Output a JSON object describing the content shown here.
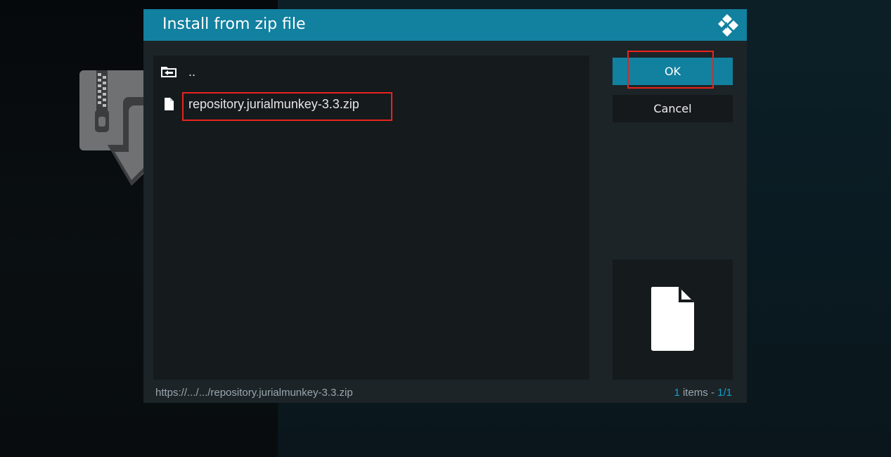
{
  "dialog": {
    "title": "Install from zip file"
  },
  "file_list": {
    "items": [
      {
        "label": "..",
        "icon": "folder-back-icon"
      },
      {
        "label": "repository.jurialmunkey-3.3.zip",
        "icon": "file-icon"
      }
    ]
  },
  "buttons": {
    "ok_label": "OK",
    "cancel_label": "Cancel"
  },
  "status": {
    "path": "https://.../.../repository.jurialmunkey-3.3.zip",
    "count": "1",
    "items_text": " items - ",
    "page": "1/1"
  },
  "colors": {
    "accent": "#12809f",
    "highlight": "#e8241e",
    "dialog_bg": "#1c2428",
    "list_bg": "#151a1d"
  }
}
